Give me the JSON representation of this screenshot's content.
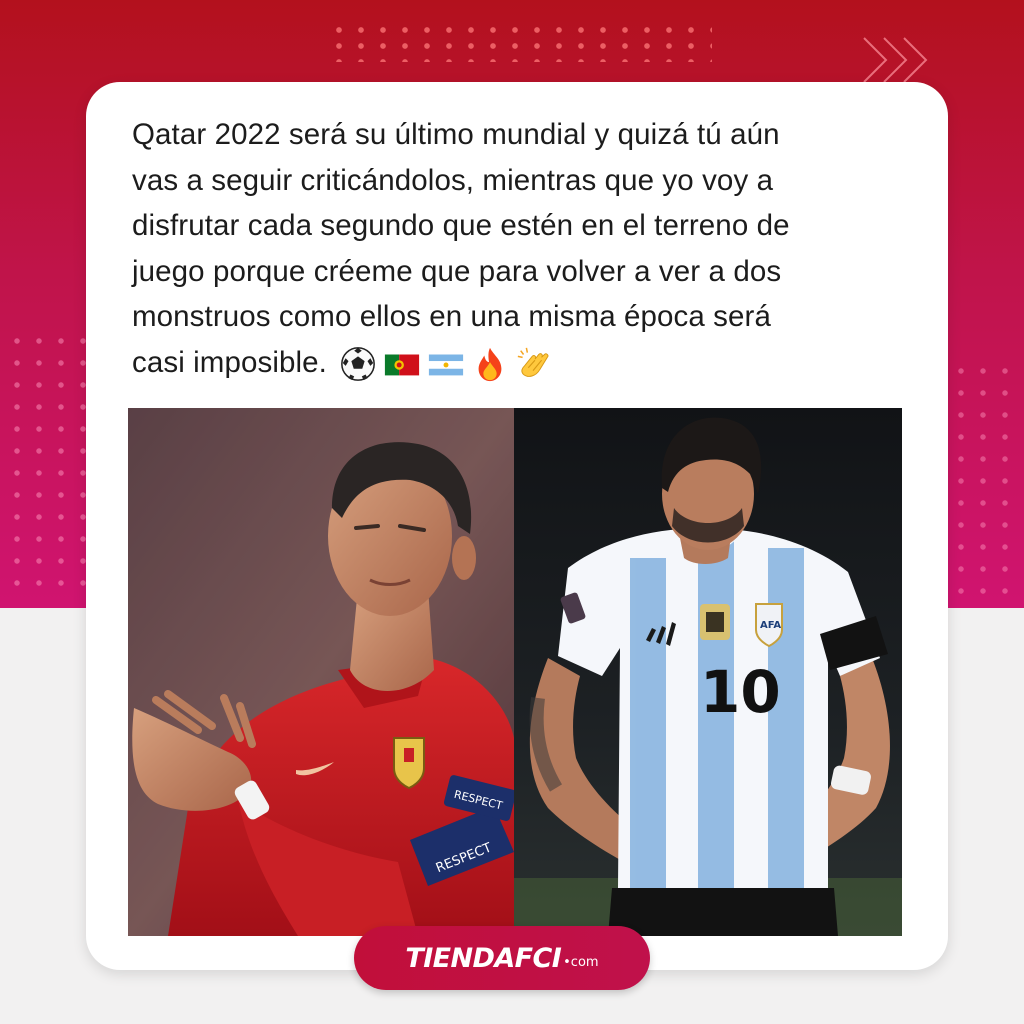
{
  "post": {
    "lines": [
      "Qatar 2022 será su último mundial y quizá tú aún",
      "vas a seguir criticándolos, mientras que yo voy a",
      "disfrutar cada segundo que estén en el terreno de",
      "juego porque créeme que para volver a ver a dos",
      "monstruos como ellos en una misma época será",
      "casi imposible."
    ],
    "emojis": [
      "soccer-ball-icon",
      "portugal-flag-icon",
      "argentina-flag-icon",
      "fire-icon",
      "clapping-hands-icon"
    ]
  },
  "photo": {
    "left": {
      "jersey_color": "#c8141c",
      "armband": "RESPECT",
      "sleeve_badge": "RESPECT"
    },
    "right": {
      "jersey_number": "10",
      "badge_text": "AFA",
      "armband_color": "#111111"
    }
  },
  "brand": {
    "logo_text": "TIENDAFCI",
    "logo_suffix": "•com",
    "accent": "#c10f3a",
    "band_top": "#b3111d",
    "band_bottom": "#d01470"
  }
}
